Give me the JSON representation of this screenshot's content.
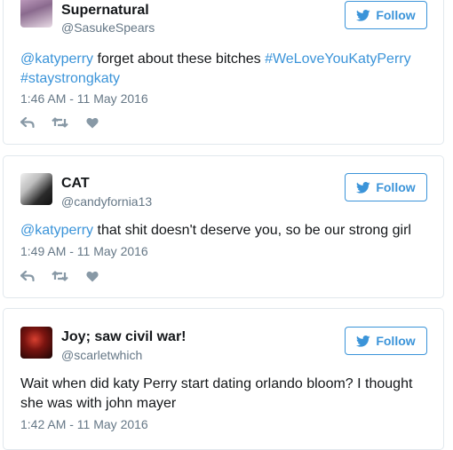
{
  "follow_label": "Follow",
  "colors": {
    "link": "#3b94d9",
    "text": "#14171a",
    "muted": "#657786",
    "border": "#e1e8ed",
    "action_icon": "#8899a6"
  },
  "icons": {
    "follow": "twitter-bird-icon",
    "reply": "reply-icon",
    "retweet": "retweet-icon",
    "like": "heart-icon"
  },
  "tweets": [
    {
      "name": "Supernatural",
      "handle": "@SasukeSpears",
      "text": {
        "mention": "@katyperry",
        "body": " forget about these bitches ",
        "hashtag1": "#WeLoveYouKatyPerry",
        "hashtag2": "#staystrongkaty"
      },
      "timestamp": "1:46 AM - 11 May 2016"
    },
    {
      "name": "CAT",
      "handle": "@candyfornia13",
      "text": {
        "mention": "@katyperry",
        "body": " that shit doesn't deserve you, so be our strong girl"
      },
      "timestamp": "1:49 AM - 11 May 2016"
    },
    {
      "name": "Joy; saw civil war!",
      "handle": "@scarletwhich",
      "text": {
        "body": "Wait when did katy Perry start dating orlando bloom? I thought she was with john mayer"
      },
      "timestamp": "1:42 AM - 11 May 2016"
    }
  ]
}
